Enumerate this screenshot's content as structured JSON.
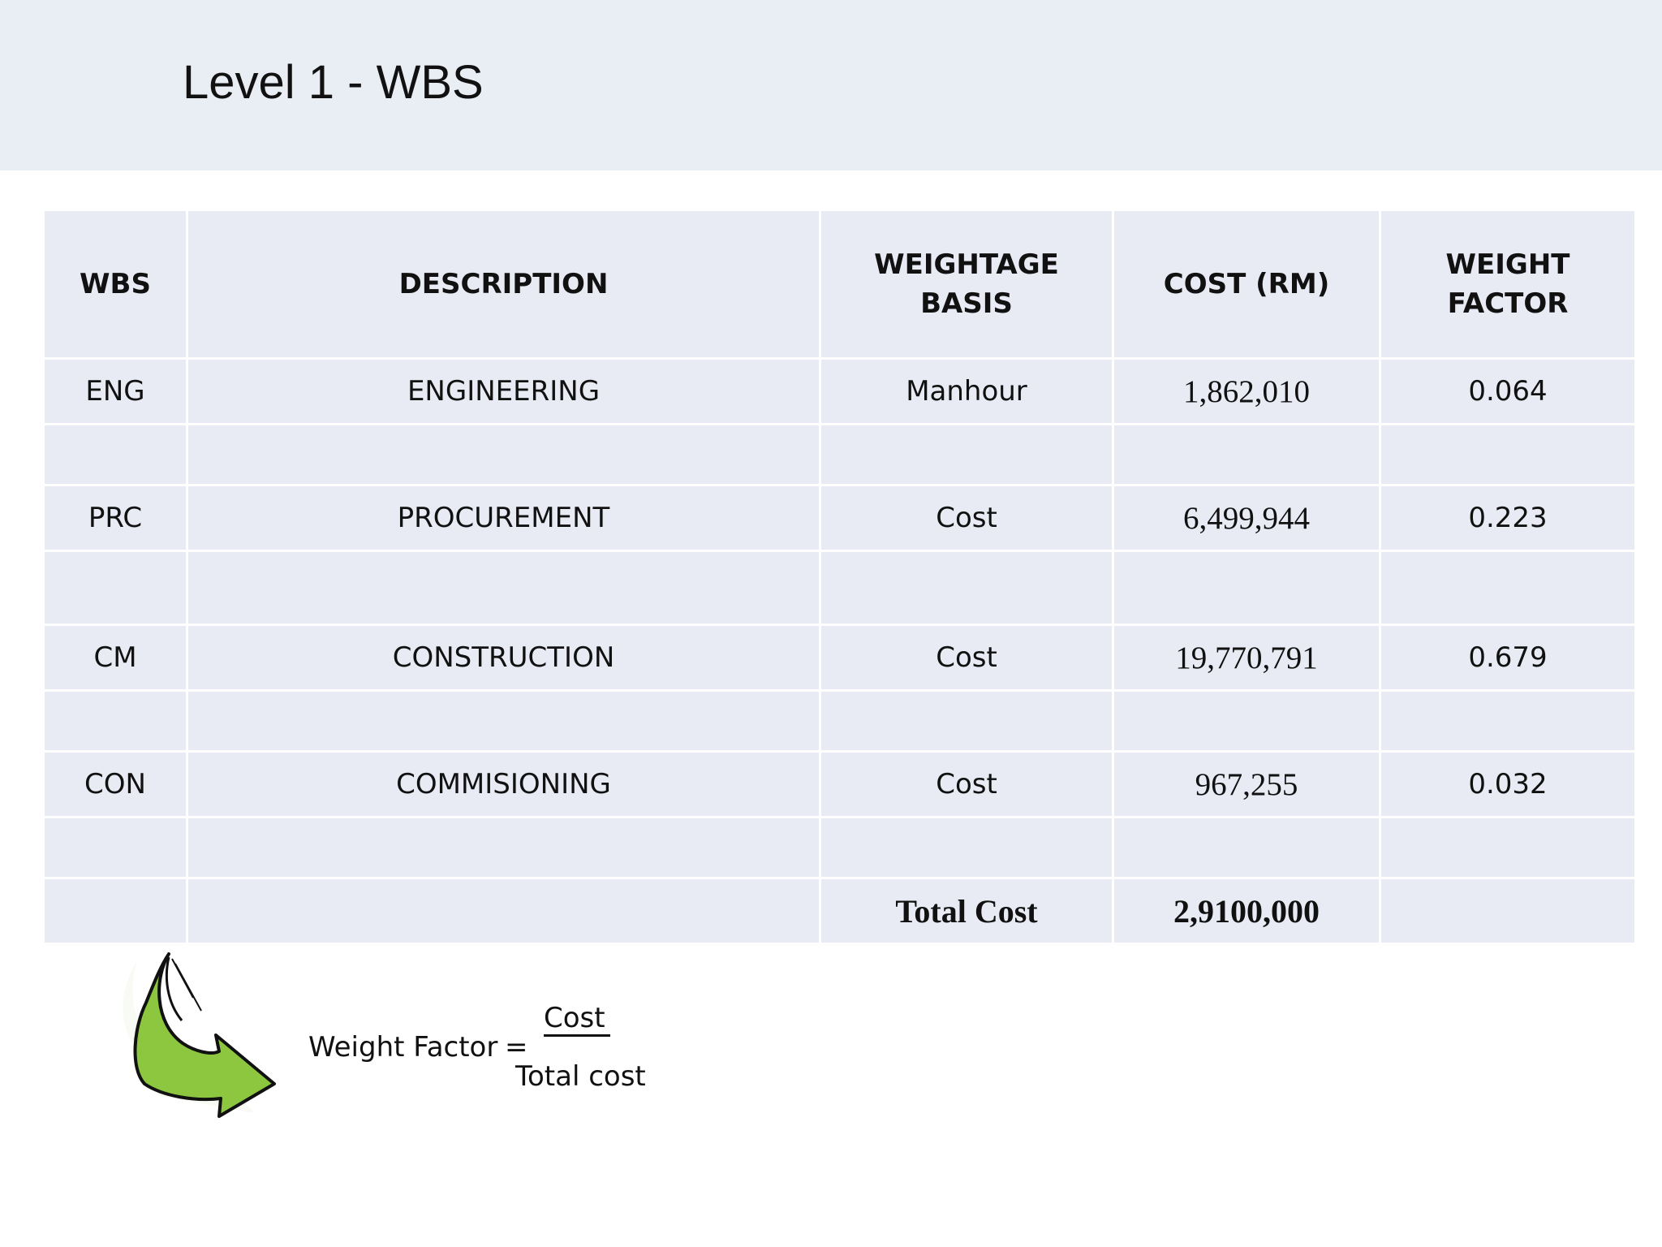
{
  "slide": {
    "title": "Level 1 - WBS"
  },
  "table": {
    "headers": [
      "WBS",
      "DESCRIPTION",
      "WEIGHTAGE BASIS",
      "COST (RM)",
      "WEIGHT FACTOR"
    ],
    "rows": [
      {
        "wbs": "ENG",
        "description": "ENGINEERING",
        "basis": "Manhour",
        "cost": "1,862,010",
        "factor": "0.064"
      },
      {
        "wbs": "PRC",
        "description": "PROCUREMENT",
        "basis": "Cost",
        "cost": "6,499,944",
        "factor": "0.223"
      },
      {
        "wbs": "CM",
        "description": "CONSTRUCTION",
        "basis": "Cost",
        "cost": "19,770,791",
        "factor": "0.679"
      },
      {
        "wbs": "CON",
        "description": "COMMISIONING",
        "basis": "Cost",
        "cost": "967,255",
        "factor": "0.032"
      }
    ],
    "total": {
      "label": "Total Cost",
      "value": "2,9100,000"
    }
  },
  "formula": {
    "label": "Weight Factor",
    "equals": "=",
    "numerator": "Cost",
    "denominator": "Total cost"
  },
  "icons": {
    "arrow": "curved-arrow-icon",
    "arrow_fill": "#8dc63f",
    "arrow_stroke": "#111111"
  }
}
